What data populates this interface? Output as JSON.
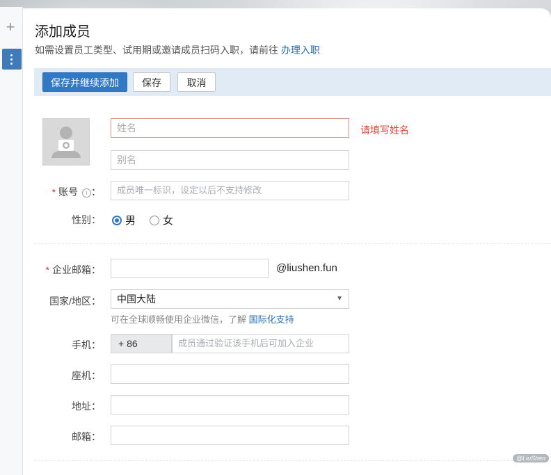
{
  "page": {
    "title": "添加成员",
    "subtitle_text": "如需设置员工类型、试用期或邀请成员扫码入职，请前往 ",
    "subtitle_link": "办理入职"
  },
  "toolbar": {
    "save_continue_label": "保存并继续添加",
    "save_label": "保存",
    "cancel_label": "取消"
  },
  "form": {
    "name": {
      "placeholder": "姓名",
      "error": "请填写姓名"
    },
    "alias": {
      "placeholder": "别名"
    },
    "account": {
      "required_mark": "*",
      "label": "账号",
      "info_icon": "i",
      "colon": "：",
      "placeholder": "成员唯一标识，设定以后不支持修改"
    },
    "gender": {
      "label": "性别：",
      "options": [
        "男",
        "女"
      ],
      "selected": "男"
    },
    "email": {
      "required_mark": "*",
      "label": "企业邮箱：",
      "value": "",
      "domain": "@liushen.fun"
    },
    "country": {
      "label": "国家/地区：",
      "value": "中国大陆",
      "arrow": "▼",
      "hint_text": "可在全球顺畅使用企业微信，了解 ",
      "hint_link": "国际化支持"
    },
    "mobile": {
      "label": "手机：",
      "prefix": "+ 86",
      "placeholder": "成员通过验证该手机后可加入企业"
    },
    "landline": {
      "label": "座机：",
      "value": ""
    },
    "address": {
      "label": "地址：",
      "value": ""
    },
    "mail": {
      "label": "邮箱：",
      "value": ""
    }
  },
  "sidebar": {
    "add_icon": "+",
    "more_icon": "more-vertical-icon"
  },
  "watermark": "@LiuShen",
  "colors": {
    "primary": "#3279c5",
    "error": "#e0453a",
    "link": "#2a6db5",
    "toolbar_bg": "#e1ebf6"
  }
}
